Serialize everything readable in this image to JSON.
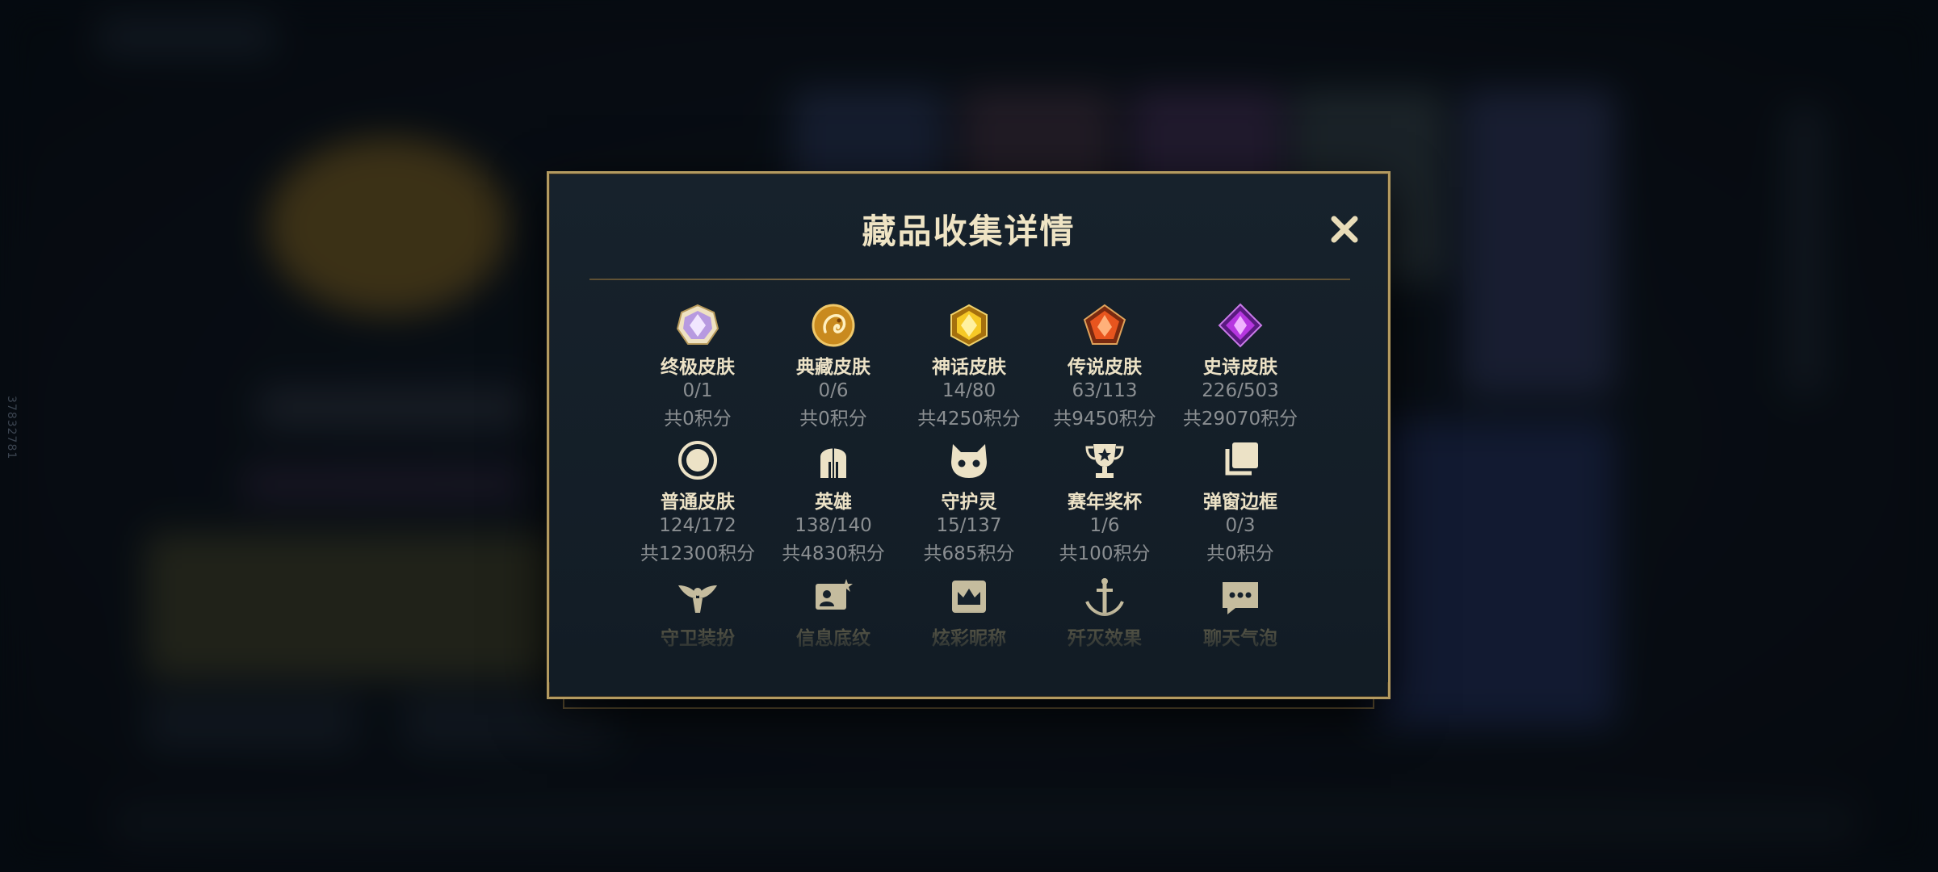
{
  "side_id": "37832781",
  "modal": {
    "title": "藏品收集详情",
    "close_icon": "close-icon"
  },
  "categories": [
    {
      "name": "终极皮肤",
      "count": "0/1",
      "points": "共0积分",
      "icon": "ultimate-gem-icon"
    },
    {
      "name": "典藏皮肤",
      "count": "0/6",
      "points": "共0积分",
      "icon": "dragon-emblem-icon"
    },
    {
      "name": "神话皮肤",
      "count": "14/80",
      "points": "共4250积分",
      "icon": "gold-gem-icon"
    },
    {
      "name": "传说皮肤",
      "count": "63/113",
      "points": "共9450积分",
      "icon": "orange-gem-icon"
    },
    {
      "name": "史诗皮肤",
      "count": "226/503",
      "points": "共29070积分",
      "icon": "purple-gem-icon"
    },
    {
      "name": "普通皮肤",
      "count": "124/172",
      "points": "共12300积分",
      "icon": "ring-icon"
    },
    {
      "name": "英雄",
      "count": "138/140",
      "points": "共4830积分",
      "icon": "helmet-icon"
    },
    {
      "name": "守护灵",
      "count": "15/137",
      "points": "共685积分",
      "icon": "guardian-face-icon"
    },
    {
      "name": "赛年奖杯",
      "count": "1/6",
      "points": "共100积分",
      "icon": "trophy-icon"
    },
    {
      "name": "弹窗边框",
      "count": "0/3",
      "points": "共0积分",
      "icon": "stacked-frames-icon"
    },
    {
      "name": "守卫装扮",
      "icon": "winged-ward-icon"
    },
    {
      "name": "信息底纹",
      "icon": "profile-card-icon"
    },
    {
      "name": "炫彩昵称",
      "icon": "crown-frame-icon"
    },
    {
      "name": "歼灭效果",
      "icon": "sword-icon"
    },
    {
      "name": "聊天气泡",
      "icon": "chat-bubble-icon"
    }
  ],
  "colors": {
    "gold_border": "#b39a60",
    "title": "#efe4c4",
    "label": "#ece2c6",
    "muted": "#8b8f92"
  }
}
